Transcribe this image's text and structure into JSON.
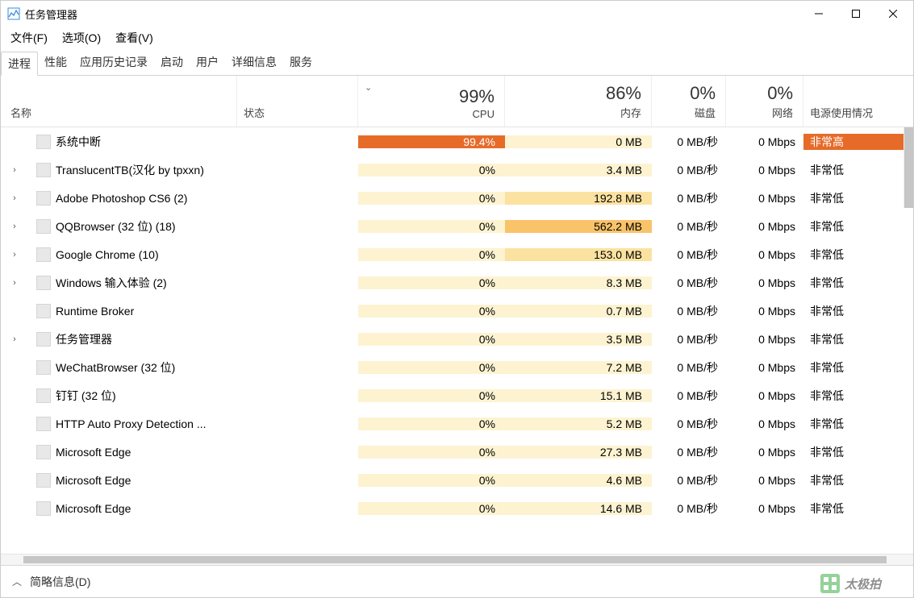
{
  "window": {
    "title": "任务管理器"
  },
  "menu": {
    "file": "文件(F)",
    "options": "选项(O)",
    "view": "查看(V)"
  },
  "tabs": [
    "进程",
    "性能",
    "应用历史记录",
    "启动",
    "用户",
    "详细信息",
    "服务"
  ],
  "columns": {
    "name": "名称",
    "status": "状态",
    "cpu": {
      "pct": "99%",
      "label": "CPU"
    },
    "memory": {
      "pct": "86%",
      "label": "内存"
    },
    "disk": {
      "pct": "0%",
      "label": "磁盘"
    },
    "network": {
      "pct": "0%",
      "label": "网络"
    },
    "power": "电源使用情况"
  },
  "processes": [
    {
      "expandable": false,
      "name": "系统中断",
      "cpu": "99.4%",
      "mem": "0 MB",
      "disk": "0 MB/秒",
      "net": "0 Mbps",
      "power": "非常高",
      "highlight": true,
      "mem_heat": "low"
    },
    {
      "expandable": true,
      "name": "TranslucentTB(汉化 by tpxxn)",
      "cpu": "0%",
      "mem": "3.4 MB",
      "disk": "0 MB/秒",
      "net": "0 Mbps",
      "power": "非常低",
      "mem_heat": "low"
    },
    {
      "expandable": true,
      "name": "Adobe Photoshop CS6 (2)",
      "cpu": "0%",
      "mem": "192.8 MB",
      "disk": "0 MB/秒",
      "net": "0 Mbps",
      "power": "非常低",
      "mem_heat": "med"
    },
    {
      "expandable": true,
      "name": "QQBrowser (32 位) (18)",
      "cpu": "0%",
      "mem": "562.2 MB",
      "disk": "0 MB/秒",
      "net": "0 Mbps",
      "power": "非常低",
      "mem_heat": "high"
    },
    {
      "expandable": true,
      "name": "Google Chrome (10)",
      "cpu": "0%",
      "mem": "153.0 MB",
      "disk": "0 MB/秒",
      "net": "0 Mbps",
      "power": "非常低",
      "mem_heat": "med"
    },
    {
      "expandable": true,
      "name": "Windows 输入体验 (2)",
      "cpu": "0%",
      "mem": "8.3 MB",
      "disk": "0 MB/秒",
      "net": "0 Mbps",
      "power": "非常低",
      "mem_heat": "low"
    },
    {
      "expandable": false,
      "name": "Runtime Broker",
      "cpu": "0%",
      "mem": "0.7 MB",
      "disk": "0 MB/秒",
      "net": "0 Mbps",
      "power": "非常低",
      "mem_heat": "low"
    },
    {
      "expandable": true,
      "name": "任务管理器",
      "cpu": "0%",
      "mem": "3.5 MB",
      "disk": "0 MB/秒",
      "net": "0 Mbps",
      "power": "非常低",
      "mem_heat": "low"
    },
    {
      "expandable": false,
      "name": "WeChatBrowser (32 位)",
      "cpu": "0%",
      "mem": "7.2 MB",
      "disk": "0 MB/秒",
      "net": "0 Mbps",
      "power": "非常低",
      "mem_heat": "low"
    },
    {
      "expandable": false,
      "name": "钉钉 (32 位)",
      "cpu": "0%",
      "mem": "15.1 MB",
      "disk": "0 MB/秒",
      "net": "0 Mbps",
      "power": "非常低",
      "mem_heat": "low"
    },
    {
      "expandable": false,
      "name": "HTTP Auto Proxy Detection ...",
      "cpu": "0%",
      "mem": "5.2 MB",
      "disk": "0 MB/秒",
      "net": "0 Mbps",
      "power": "非常低",
      "mem_heat": "low"
    },
    {
      "expandable": false,
      "name": "Microsoft Edge",
      "cpu": "0%",
      "mem": "27.3 MB",
      "disk": "0 MB/秒",
      "net": "0 Mbps",
      "power": "非常低",
      "mem_heat": "low"
    },
    {
      "expandable": false,
      "name": "Microsoft Edge",
      "cpu": "0%",
      "mem": "4.6 MB",
      "disk": "0 MB/秒",
      "net": "0 Mbps",
      "power": "非常低",
      "mem_heat": "low"
    },
    {
      "expandable": false,
      "name": "Microsoft Edge",
      "cpu": "0%",
      "mem": "14.6 MB",
      "disk": "0 MB/秒",
      "net": "0 Mbps",
      "power": "非常低",
      "mem_heat": "low"
    }
  ],
  "footer": {
    "fewer_details": "简略信息(D)"
  }
}
